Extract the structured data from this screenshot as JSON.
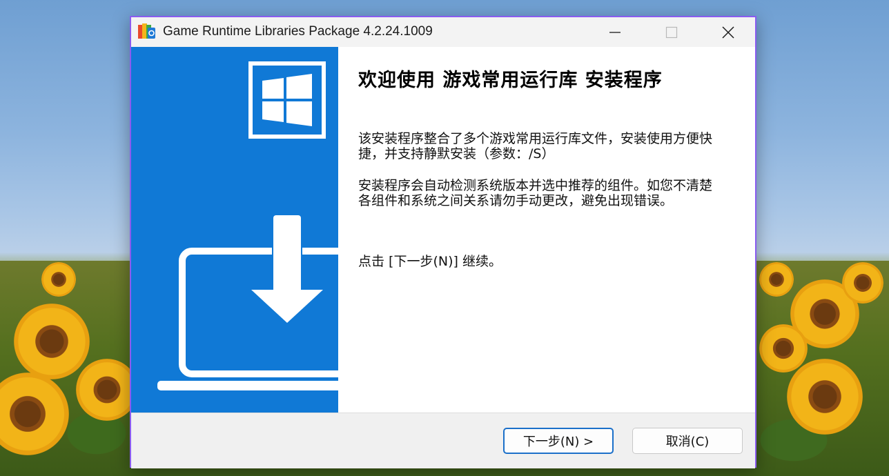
{
  "window": {
    "title": "Game Runtime Libraries Package 4.2.24.1009"
  },
  "main": {
    "heading": "欢迎使用 游戏常用运行库 安装程序",
    "paragraph1": "该安装程序整合了多个游戏常用运行库文件，安装使用方便快捷，并支持静默安装（参数：/S）",
    "paragraph2": "安装程序会自动检测系统版本并选中推荐的组件。如您不清楚各组件和系统之间关系请勿手动更改，避免出现错误。",
    "paragraph3": "点击 [下一步(N)] 继续。"
  },
  "footer": {
    "next_label": "下一步(N) >",
    "cancel_label": "取消(C)"
  },
  "colors": {
    "accent": "#1079d6",
    "window_border": "#8a5cf0"
  },
  "icons": {
    "app": "colorful-package-icon",
    "logo": "windows-logo-icon",
    "download": "download-arrow-icon",
    "laptop": "laptop-icon"
  }
}
